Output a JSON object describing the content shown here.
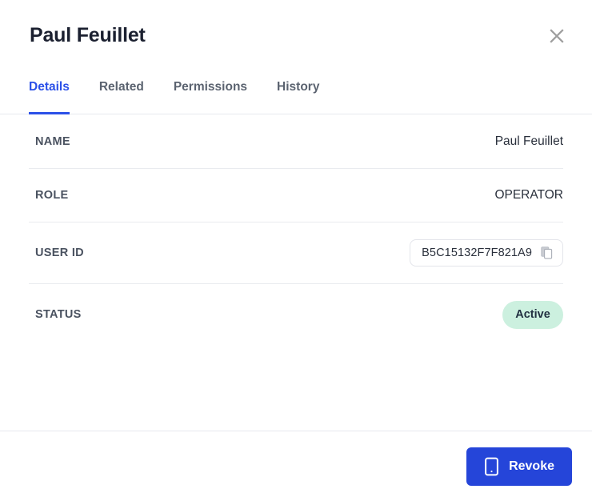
{
  "header": {
    "title": "Paul Feuillet",
    "close_icon": "close-icon"
  },
  "tabs": [
    {
      "label": "Details",
      "active": true
    },
    {
      "label": "Related",
      "active": false
    },
    {
      "label": "Permissions",
      "active": false
    },
    {
      "label": "History",
      "active": false
    }
  ],
  "details": {
    "rows": [
      {
        "label": "NAME",
        "value": "Paul Feuillet",
        "type": "text"
      },
      {
        "label": "ROLE",
        "value": "OPERATOR",
        "type": "text"
      },
      {
        "label": "USER ID",
        "value": "B5C15132F7F821A9",
        "type": "copyable",
        "icon": "copy-icon"
      },
      {
        "label": "STATUS",
        "value": "Active",
        "type": "badge"
      }
    ]
  },
  "footer": {
    "primary_button": {
      "label": "Revoke",
      "icon": "mobile-device-icon"
    }
  },
  "colors": {
    "accent": "#2b50e8",
    "button": "#2545d9",
    "badge_bg": "#ccf0df",
    "badge_text": "#213041",
    "title_text": "#1b2030",
    "label_text": "#4a5260",
    "tab_inactive": "#5b6370",
    "divider": "#e7e9ee"
  }
}
